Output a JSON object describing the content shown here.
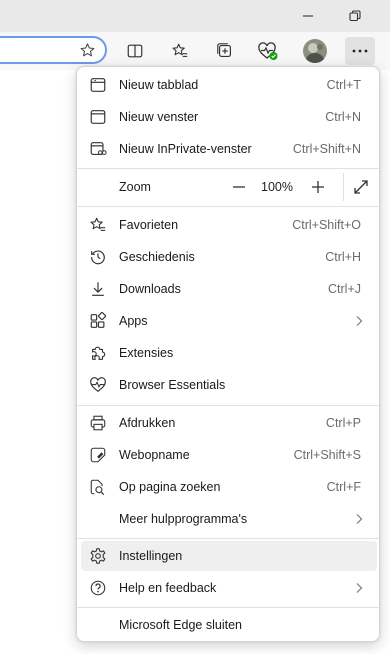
{
  "toolbar": {
    "icons": [
      "star-outline-icon",
      "split-screen-icon",
      "favorites-icon",
      "collections-icon",
      "browser-essentials-icon",
      "profile-avatar",
      "more-icon"
    ]
  },
  "menu": {
    "items_top": [
      {
        "label": "Nieuw tabblad",
        "shortcut": "Ctrl+T",
        "icon": "new-tab-icon"
      },
      {
        "label": "Nieuw venster",
        "shortcut": "Ctrl+N",
        "icon": "new-window-icon"
      },
      {
        "label": "Nieuw InPrivate-venster",
        "shortcut": "Ctrl+Shift+N",
        "icon": "inprivate-icon"
      }
    ],
    "zoom": {
      "label": "Zoom",
      "value": "100%",
      "minus": "−",
      "plus": "+"
    },
    "items_mid": [
      {
        "label": "Favorieten",
        "shortcut": "Ctrl+Shift+O",
        "icon": "favorites-icon"
      },
      {
        "label": "Geschiedenis",
        "shortcut": "Ctrl+H",
        "icon": "history-icon"
      },
      {
        "label": "Downloads",
        "shortcut": "Ctrl+J",
        "icon": "download-icon"
      },
      {
        "label": "Apps",
        "shortcut": "",
        "icon": "apps-icon",
        "submenu": true
      },
      {
        "label": "Extensies",
        "shortcut": "",
        "icon": "extensions-icon"
      },
      {
        "label": "Browser Essentials",
        "shortcut": "",
        "icon": "heartbeat-icon"
      }
    ],
    "items_tools": [
      {
        "label": "Afdrukken",
        "shortcut": "Ctrl+P",
        "icon": "print-icon"
      },
      {
        "label": "Webopname",
        "shortcut": "Ctrl+Shift+S",
        "icon": "web-capture-icon"
      },
      {
        "label": "Op pagina zoeken",
        "shortcut": "Ctrl+F",
        "icon": "find-icon"
      },
      {
        "label": "Meer hulpprogramma's",
        "shortcut": "",
        "icon": "",
        "submenu": true
      }
    ],
    "items_settings": [
      {
        "label": "Instellingen",
        "shortcut": "",
        "icon": "settings-icon"
      },
      {
        "label": "Help en feedback",
        "shortcut": "",
        "icon": "help-icon",
        "submenu": true
      }
    ],
    "close_label": "Microsoft Edge sluiten"
  },
  "colors": {
    "accent": "#6c9be7",
    "hover": "#efefef",
    "badge": "#13a10e"
  }
}
